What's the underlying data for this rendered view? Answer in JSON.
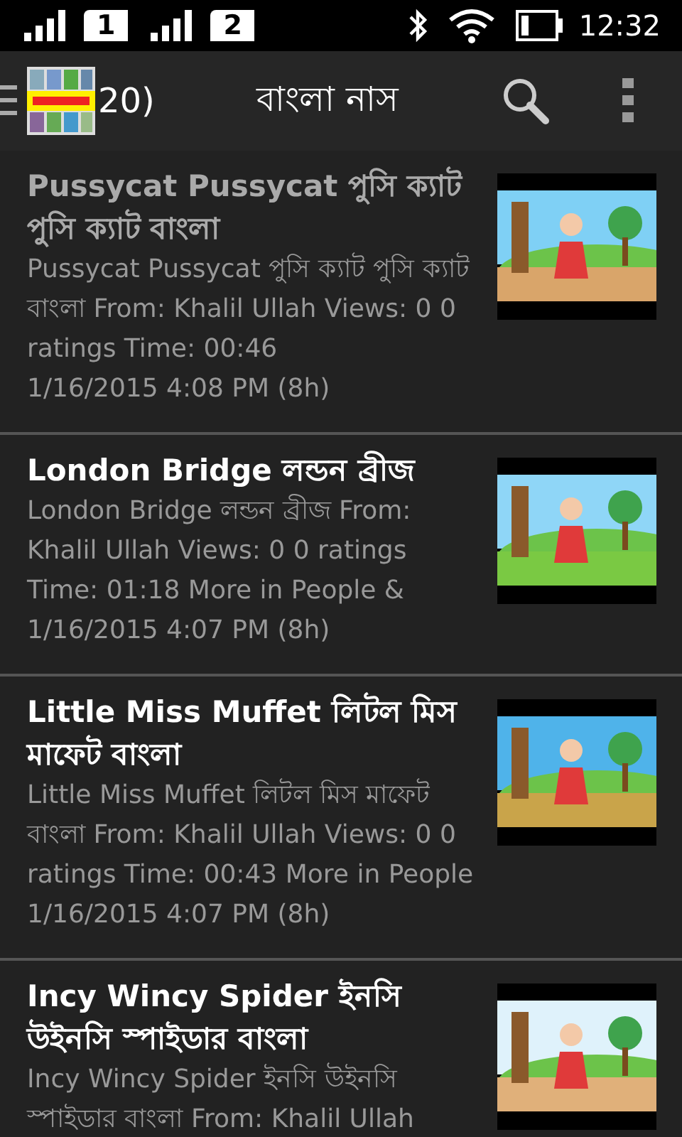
{
  "status_bar": {
    "sim_badges": [
      "1",
      "2"
    ],
    "time": "12:32"
  },
  "app_bar": {
    "count": "20)",
    "title": "বাংলা নাস"
  },
  "videos": [
    {
      "title": "Pussycat Pussycat পুসি ক্যাট পুসি ক্যাট বাংলা",
      "description": "Pussycat Pussycat পুসি ক্যাট পুসি ক্যাট বাংলা From: Khalil Ullah Views: 0 0 ratings Time: 00:46",
      "date": "1/16/2015 4:08 PM (8h)",
      "read": true
    },
    {
      "title": "London Bridge লন্ডন ব্রীজ",
      "description": "London Bridge লন্ডন ব্রীজ From: Khalil Ullah Views: 0 0 ratings Time: 01:18 More in People &",
      "date": "1/16/2015 4:07 PM (8h)",
      "read": false
    },
    {
      "title": "Little Miss Muffet লিটল মিস মাফেট বাংলা",
      "description": "Little Miss Muffet লিটল মিস মাফেট বাংলা From: Khalil Ullah Views: 0 0 ratings Time: 00:43 More in People",
      "date": "1/16/2015 4:07 PM (8h)",
      "read": false
    },
    {
      "title": "Incy Wincy Spider ইনসি উইনসি স্পাইডার বাংলা",
      "description": "Incy Wincy Spider ইনসি উইনসি স্পাইডার বাংলা From: Khalil Ullah",
      "read": false
    }
  ]
}
